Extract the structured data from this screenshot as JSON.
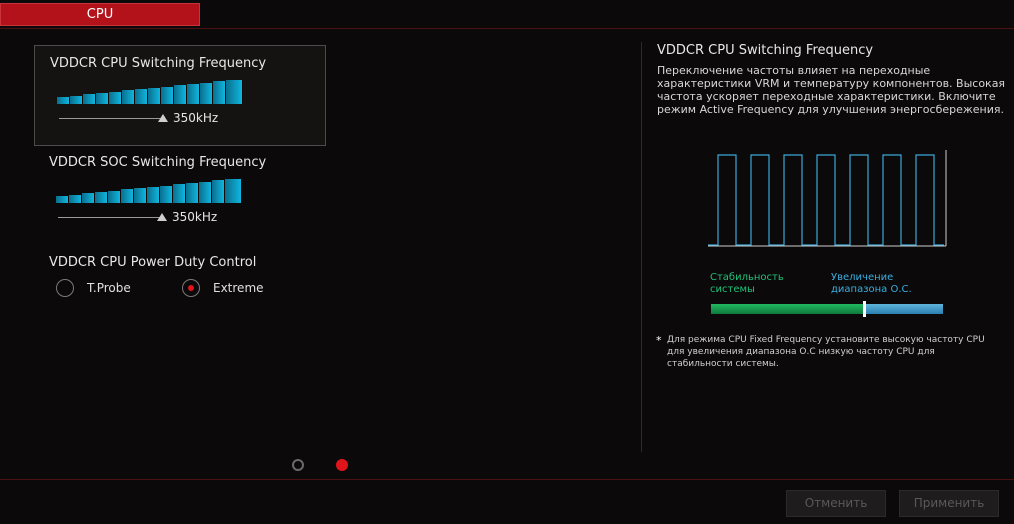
{
  "tab": {
    "label": "CPU"
  },
  "settings": [
    {
      "title": "VDDCR CPU Switching Frequency",
      "value": "350kHz",
      "level": 0.5,
      "bar_count": 14
    },
    {
      "title": "VDDCR SOC Switching Frequency",
      "value": "350kHz",
      "level": 0.5,
      "bar_count": 14
    }
  ],
  "duty_control": {
    "title": "VDDCR CPU Power Duty Control",
    "options": [
      {
        "label": "T.Probe",
        "selected": false
      },
      {
        "label": "Extreme",
        "selected": true
      }
    ]
  },
  "pagination": {
    "pages": 2,
    "current": 2
  },
  "help": {
    "title": "VDDCR CPU Switching Frequency",
    "description": "Переключение частоты влияет на переходные характеристики VRM и температуру компонентов. Высокая частота ускоряет переходные характеристики. Включите режим Active Frequency для улучшения энергосбережения.",
    "stability_label": "Стабильность системы",
    "oc_label": "Увеличение диапазона О.С.",
    "marker_position": 0.66,
    "note_star": "*",
    "note": "Для режима CPU Fixed Frequency установите высокую частоту CPU для увеличения диапазона О.С низкую частоту CPU для стабильности системы."
  },
  "buttons": {
    "cancel": "Отменить",
    "apply": "Применить"
  },
  "colors": {
    "accent_red": "#b3121a",
    "bar_cyan": "#0fb6e0",
    "stability_green": "#21c07a",
    "oc_blue": "#3aaee0"
  }
}
